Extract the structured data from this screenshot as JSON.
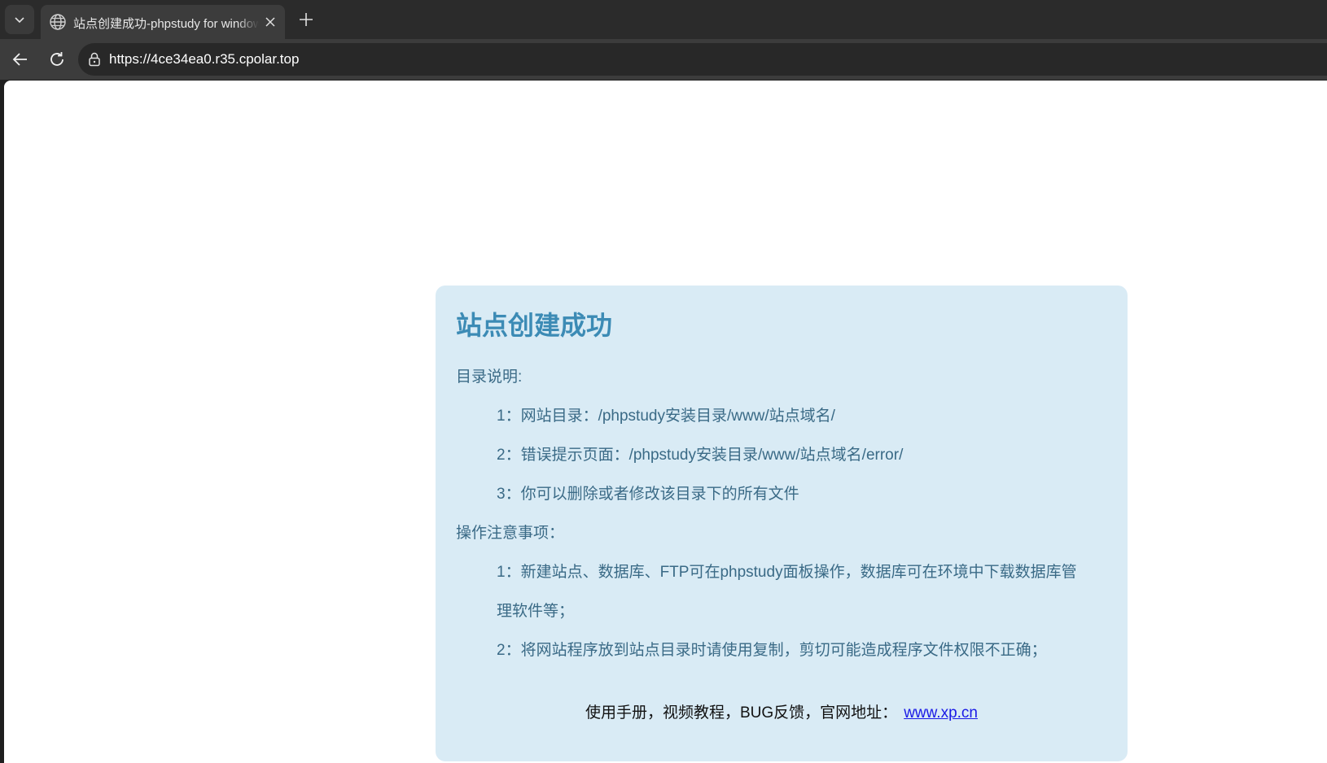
{
  "browser": {
    "tab": {
      "title": "站点创建成功-phpstudy for windows"
    },
    "address_bar": {
      "url": "https://4ce34ea0.r35.cpolar.top"
    }
  },
  "page": {
    "title": "站点创建成功",
    "directory_section": {
      "label": "目录说明:",
      "items": [
        "1：网站目录：/phpstudy安装目录/www/站点域名/",
        "2：错误提示页面：/phpstudy安装目录/www/站点域名/error/",
        "3：你可以删除或者修改该目录下的所有文件"
      ]
    },
    "notes_section": {
      "label": "操作注意事项：",
      "items": [
        {
          "line1": "1：新建站点、数据库、FTP可在phpstudy面板操作，数据库可在环境中下载数据库管",
          "line2": "理软件等；"
        },
        {
          "line1": "2：将网站程序放到站点目录时请使用复制，剪切可能造成程序文件权限不正确；"
        }
      ]
    },
    "footer": {
      "text": "使用手册，视频教程，BUG反馈，官网地址：",
      "link_text": "www.xp.cn"
    }
  },
  "colors": {
    "card_background": "#d9ebf5",
    "title": "#3c8bb5",
    "body_text": "#3a6a86",
    "link": "#1a1ae6"
  }
}
